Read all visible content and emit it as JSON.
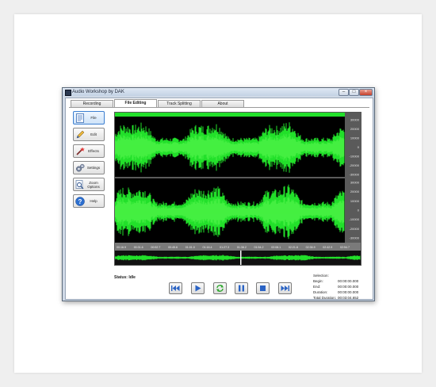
{
  "window": {
    "title": "Audio Workshop by DAK"
  },
  "tabs": [
    {
      "label": "Recording"
    },
    {
      "label": "File Editing",
      "active": true
    },
    {
      "label": "Track Splitting"
    },
    {
      "label": "About"
    }
  ],
  "sidebar": {
    "items": [
      {
        "label": "File",
        "icon": "document-icon"
      },
      {
        "label": "Edit",
        "icon": "pencil-icon"
      },
      {
        "label": "Effects",
        "icon": "magic-wand-icon"
      },
      {
        "label": "Settings",
        "icon": "gears-icon"
      },
      {
        "label": "Zoom Options",
        "icon": "magnifier-icon"
      },
      {
        "label": "Help",
        "icon": "help-icon"
      }
    ]
  },
  "waveform": {
    "scale_top": [
      "30000",
      "20000",
      "10000",
      "0",
      "-10000",
      "-20000",
      "-30000"
    ],
    "scale_bottom": [
      "30000",
      "20000",
      "10000",
      "0",
      "-10000",
      "-20000",
      "-30000"
    ],
    "timeline": [
      "00:16.9",
      "00:31.6",
      "00:52.7",
      "00:45.6",
      "01:01.0",
      "01:16.4",
      "01:27.3",
      "01:38.2",
      "01:54.2",
      "02:08.1",
      "02:21.8",
      "02:36.9",
      "02:42.9",
      "02:54.7"
    ],
    "colors": {
      "wave": "#22e02a",
      "wave_bright": "#6bff5a",
      "background": "#000000"
    }
  },
  "status": {
    "text": "Status: Idle"
  },
  "transport": [
    {
      "icon": "skip-back-icon"
    },
    {
      "icon": "play-icon"
    },
    {
      "icon": "loop-icon"
    },
    {
      "icon": "pause-icon"
    },
    {
      "icon": "stop-icon"
    },
    {
      "icon": "skip-forward-icon"
    }
  ],
  "selection": {
    "heading": "Selection:",
    "begin_label": "Begin:",
    "begin_value": "00:00:00.000",
    "end_label": "End:",
    "end_value": "00:00:00.000",
    "duration_label": "Duration:",
    "duration_value": "00:00:00.000",
    "total_label": "Total Duration:",
    "total_value": "00:03:04.652"
  }
}
